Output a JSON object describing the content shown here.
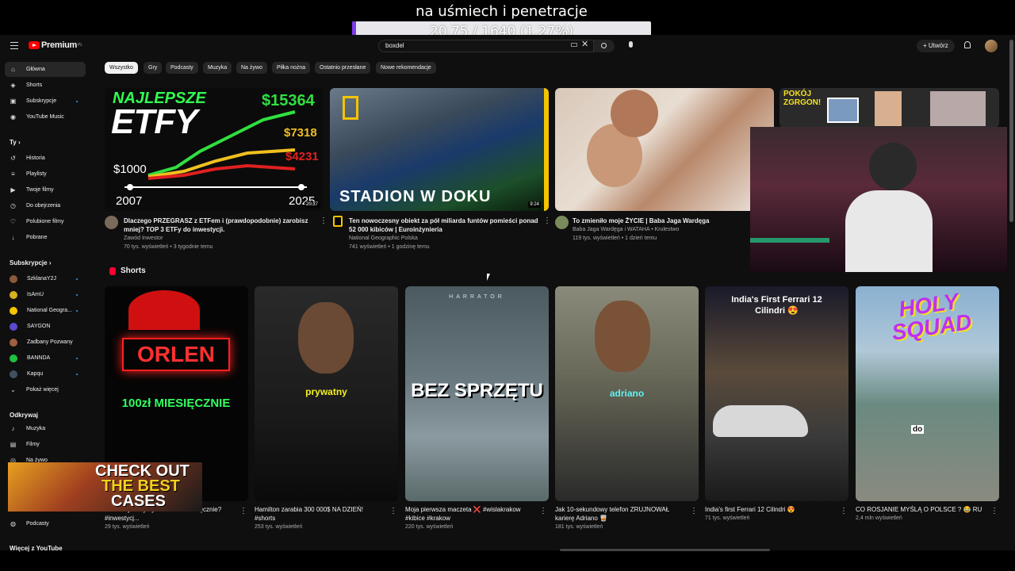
{
  "overlay": {
    "title": "na uśmiech i penetracje",
    "progress_text": "20.75 / 1640 (1.27%)",
    "progress_fraction": 0.0127,
    "progress_color": "#7c3aed"
  },
  "topbar": {
    "logo": "Premium",
    "logo_region": "PL",
    "search_value": "boxdel",
    "create_label": "Utwórz"
  },
  "sidebar": {
    "main": [
      {
        "label": "Główna",
        "icon": "home-icon"
      },
      {
        "label": "Shorts",
        "icon": "shorts-icon"
      },
      {
        "label": "Subskrypcje",
        "icon": "subscriptions-icon"
      },
      {
        "label": "YouTube Music",
        "icon": "music-icon"
      }
    ],
    "you_heading": "Ty",
    "you": [
      {
        "label": "Historia",
        "icon": "history-icon"
      },
      {
        "label": "Playlisty",
        "icon": "playlist-icon"
      },
      {
        "label": "Twoje filmy",
        "icon": "video-icon"
      },
      {
        "label": "Do obejrzenia",
        "icon": "clock-icon"
      },
      {
        "label": "Polubione filmy",
        "icon": "like-icon"
      },
      {
        "label": "Pobrane",
        "icon": "download-icon"
      }
    ],
    "subs_heading": "Subskrypcje",
    "subs": [
      {
        "label": "SzklanaY2J",
        "color": "#8a5a3a"
      },
      {
        "label": "IsAmU",
        "color": "#d8b020"
      },
      {
        "label": "National Geogra...",
        "color": "#f5c400"
      },
      {
        "label": "SAYGON",
        "color": "#5a4ad0"
      },
      {
        "label": "Zadbany Pozwany",
        "color": "#a06040"
      },
      {
        "label": "BANNDA",
        "color": "#20c040"
      },
      {
        "label": "Kapqu",
        "color": "#405060"
      }
    ],
    "show_more": "Pokaż więcej",
    "explore_heading": "Odkrywaj",
    "explore": [
      {
        "label": "Muzyka",
        "icon": "music-note-icon"
      },
      {
        "label": "Filmy",
        "icon": "film-icon"
      },
      {
        "label": "Na żywo",
        "icon": "live-icon"
      }
    ],
    "podcasts": "Podcasty",
    "more_heading": "Więcej z YouTube"
  },
  "chips": [
    "Wszystko",
    "Gry",
    "Podcasty",
    "Muzyka",
    "Na żywo",
    "Piłka nożna",
    "Ostatnio przesłane",
    "Nowe rekomendacje"
  ],
  "videos": [
    {
      "title": "Dlaczego PRZEGRASZ z ETFem i (prawdopodobnie) zarobisz mniej? TOP 3 ETFy do inwestycji.",
      "channel": "Zawód Inwestor",
      "meta": "70 tys. wyświetleń • 3 tygodnie temu",
      "duration": "20:37",
      "thumb_title": "NAJLEPSZE",
      "thumb_big": "ETFY",
      "values": [
        "$15364",
        "$7318",
        "$4231",
        "$1000"
      ],
      "years": [
        "2007",
        "2025"
      ]
    },
    {
      "title": "Ten nowoczesny obiekt za pół miliarda funtów pomieści ponad 52 000 kibiców | Euroinżynieria",
      "channel": "National Geographic Polska",
      "meta": "741 wyświetleń • 1 godzinę temu",
      "duration": "9:24",
      "thumb_text": "STADION W DOKU"
    },
    {
      "title": "To zmieniło moje ŻYCIE | Baba Jaga Wardęga",
      "channel": "Baba Jaga Wardęga i WATAHA • Krulestwo",
      "meta": "119 tys. wyświetleń • 1 dzień temu"
    },
    {
      "thumb_text": "POKÓJ ZGRGON!"
    }
  ],
  "shorts_heading": "Shorts",
  "shorts": [
    {
      "title": "...EN aby otrzymywać 100zł miesięcznie? #inwestycj...",
      "views": "29 tys. wyświetleń",
      "caption_top": "ORLEN",
      "caption_bottom": "100zł MIESIĘCZNIE"
    },
    {
      "title": "Hamilton zarabia 300 000$ NA DZIEŃ! #shorts",
      "views": "253 tys. wyświetleń",
      "caption": "prywatny"
    },
    {
      "title": "Moja pierwsza maczeta ❌ #wislakrakow #kibice #krakow",
      "views": "220 tys. wyświetleń",
      "caption_top": "HARRATOR",
      "caption": "BEZ SPRZĘTU"
    },
    {
      "title": "Jak 10-sekundowy telefon ZRUJNOWAŁ karierę Adriano 🥃",
      "views": "181 tys. wyświetleń",
      "caption": "adriano"
    },
    {
      "title": "India's first Ferrari 12 Cilindri 😍",
      "views": "71 tys. wyświetleń",
      "caption": "India's First Ferrari 12 Cilindri 😍"
    },
    {
      "title": "CO ROSJANIE MYŚLĄ O POLSCE ? 😂 RU",
      "views": "2,4 mln wyświetleń",
      "caption_top": "HOLY SQUAD",
      "caption": "do"
    }
  ],
  "promo": {
    "line1": "CHECK OUT",
    "line2": "THE BEST",
    "line3": "CASES"
  }
}
